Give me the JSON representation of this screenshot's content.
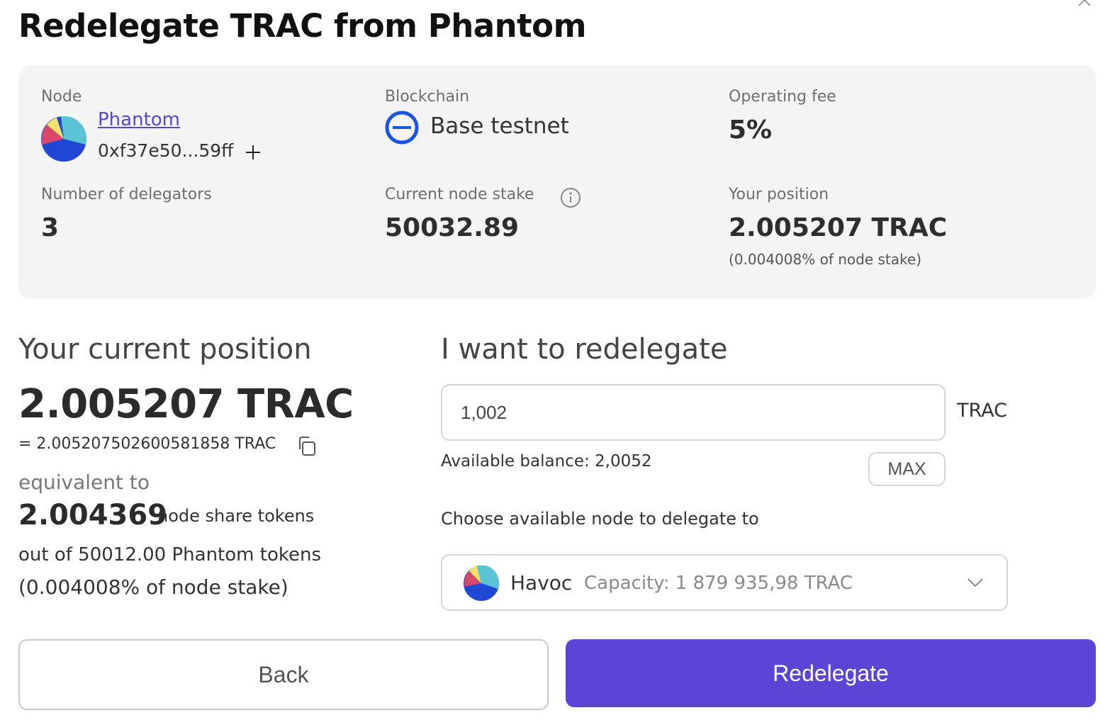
{
  "dialog": {
    "title": "Redelegate TRAC from Phantom",
    "close_icon": "close-icon"
  },
  "info": {
    "node_label": "Node",
    "node_name": "Phantom",
    "node_address": "0xf37e50...59ff",
    "add_icon": "plus-icon",
    "blockchain_label": "Blockchain",
    "blockchain_name": "Base testnet",
    "fee_label": "Operating fee",
    "fee_value": "5%",
    "delegators_label": "Number of delegators",
    "delegators_value": "3",
    "stake_label": "Current node stake",
    "stake_value": "50032.89",
    "position_label": "Your position",
    "position_value": "2.005207 TRAC",
    "position_note": "(0.004008% of node stake)"
  },
  "current_position": {
    "heading": "Your current position",
    "amount": "2.005207 TRAC",
    "exact": "= 2.005207502600581858 TRAC",
    "equivalent_label": "equivalent to",
    "share_amount": "2.004369",
    "share_unit": "node share tokens",
    "out_of": "out of 50012.00 Phantom tokens",
    "percent": "(0.004008% of node stake)"
  },
  "redelegate": {
    "heading": "I want to redelegate",
    "amount_value": "1,002",
    "unit": "TRAC",
    "available_balance": "Available balance: 2,0052",
    "max_label": "MAX",
    "choose_label": "Choose available node to delegate to",
    "selected_node_name": "Havoc",
    "selected_node_capacity": "Capacity: 1 879 935,98 TRAC"
  },
  "actions": {
    "back_label": "Back",
    "submit_label": "Redelegate"
  },
  "colors": {
    "accent": "#5b44d6",
    "panel_bg": "#f4f4f4",
    "link": "#5a45d6",
    "chain_blue": "#1a56db"
  }
}
